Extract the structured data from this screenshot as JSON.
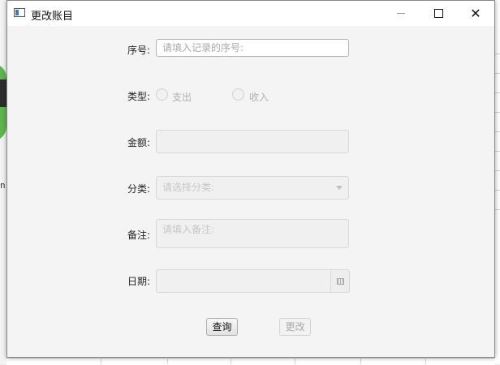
{
  "window": {
    "title": "更改账目"
  },
  "form": {
    "serial": {
      "label": "序号:",
      "placeholder": "请填入记录的序号:"
    },
    "type": {
      "label": "类型:",
      "options": [
        {
          "label": "支出"
        },
        {
          "label": "收入"
        }
      ]
    },
    "amount": {
      "label": "金额:",
      "value": ""
    },
    "category": {
      "label": "分类:",
      "placeholder": "请选择分类:"
    },
    "note": {
      "label": "备注:",
      "placeholder": "请填入备注:"
    },
    "date": {
      "label": "日期:",
      "value": ""
    }
  },
  "buttons": {
    "query": "查询",
    "update": "更改"
  },
  "background": {
    "left_letter": "n"
  }
}
